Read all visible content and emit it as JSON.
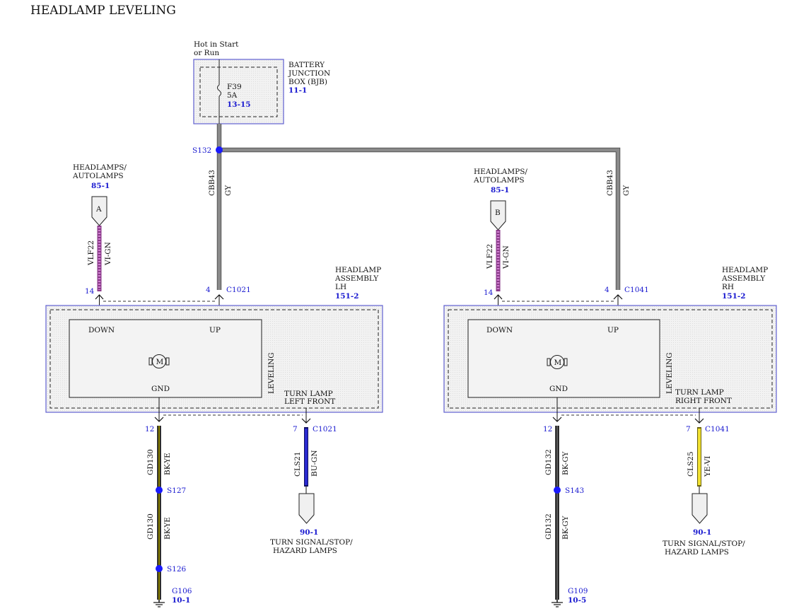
{
  "title": "HEADLAMP LEVELING",
  "power": {
    "hot_label_1": "Hot in Start",
    "hot_label_2": "or Run",
    "bjb_name_1": "BATTERY",
    "bjb_name_2": "JUNCTION",
    "bjb_name_3": "BOX (BJB)",
    "bjb_ref": "11-1",
    "fuse_name": "F39",
    "fuse_rating": "5A",
    "fuse_ref": "13-15",
    "splice": "S132"
  },
  "left": {
    "feed_label_1": "HEADLAMPS/",
    "feed_label_2": "AUTOLAMPS",
    "feed_ref": "85-1",
    "connector_letter": "A",
    "sig_circuit": "VLF22",
    "sig_color": "VI-GN",
    "sig_pin": "14",
    "pwr_circuit": "CBB43",
    "pwr_color": "GY",
    "pwr_pin": "4",
    "connector": "C1021",
    "assy_1": "HEADLAMP",
    "assy_2": "ASSEMBLY",
    "assy_3": "LH",
    "assy_ref": "151-2",
    "down": "DOWN",
    "up": "UP",
    "gnd": "GND",
    "motor": "M",
    "leveling": "LEVELING",
    "turn_1": "TURN LAMP",
    "turn_2": "LEFT FRONT",
    "gnd_pin": "12",
    "gnd_circuit": "GD130",
    "gnd_color": "BK-YE",
    "splice_1": "S127",
    "splice_2": "S126",
    "ground": "G106",
    "ground_ref": "10-1",
    "turn_pin": "7",
    "turn_connector": "C1021",
    "turn_circuit": "CLS21",
    "turn_color": "BU-GN",
    "turn_ref": "90-1",
    "turn_dest_1": "TURN SIGNAL/STOP/",
    "turn_dest_2": "HAZARD LAMPS"
  },
  "right": {
    "feed_label_1": "HEADLAMPS/",
    "feed_label_2": "AUTOLAMPS",
    "feed_ref": "85-1",
    "connector_letter": "B",
    "sig_circuit": "VLF22",
    "sig_color": "VI-GN",
    "sig_pin": "14",
    "pwr_circuit": "CBB43",
    "pwr_color": "GY",
    "pwr_pin": "4",
    "connector": "C1041",
    "assy_1": "HEADLAMP",
    "assy_2": "ASSEMBLY",
    "assy_3": "RH",
    "assy_ref": "151-2",
    "down": "DOWN",
    "up": "UP",
    "gnd": "GND",
    "motor": "M",
    "leveling": "LEVELING",
    "turn_1": "TURN LAMP",
    "turn_2": "RIGHT FRONT",
    "gnd_pin": "12",
    "gnd_circuit": "GD132",
    "gnd_color": "BK-GY",
    "splice_1": "S143",
    "ground": "G109",
    "ground_ref": "10-5",
    "turn_pin": "7",
    "turn_connector": "C1041",
    "turn_circuit": "CLS25",
    "turn_color": "YE-VI",
    "turn_ref": "90-1",
    "turn_dest_1": "TURN SIGNAL/STOP/",
    "turn_dest_2": "HAZARD LAMPS"
  },
  "colors": {
    "gray_wire": "#7a7a7a",
    "violet_green_wire": "#b060b0",
    "black_wire": "#111111",
    "blue_wire": "#2020c0",
    "yellow_wire": "#e0d020",
    "splice_dot": "#1a1aff",
    "component_outline": "#6060d0",
    "component_fill": "#f0f0f0"
  }
}
